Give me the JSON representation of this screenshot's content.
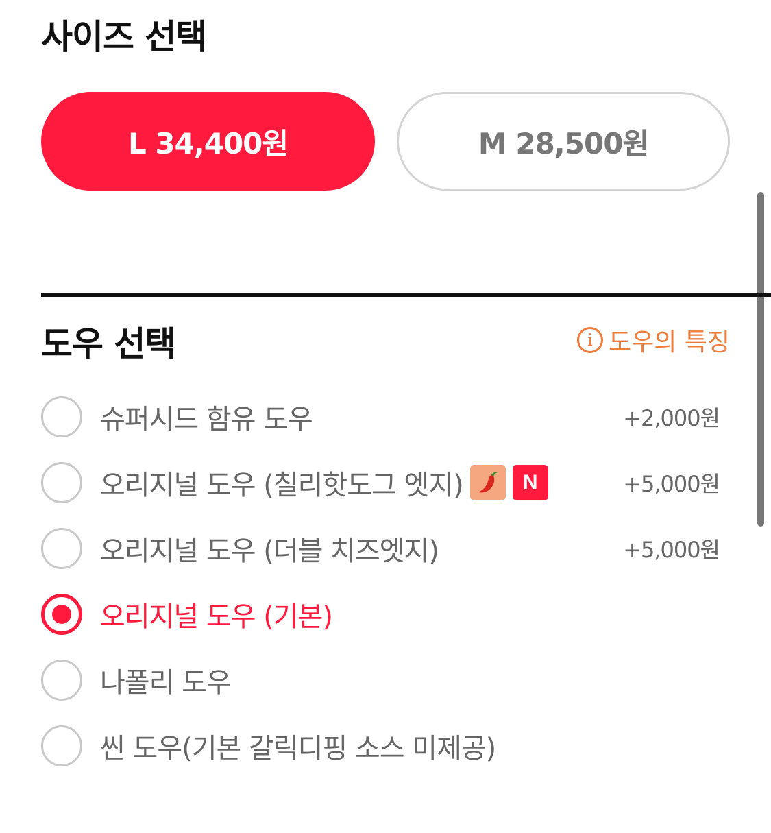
{
  "size_section": {
    "title": "사이즈 선택",
    "options": [
      {
        "label": "L 34,400원",
        "selected": true
      },
      {
        "label": "M 28,500원",
        "selected": false
      }
    ]
  },
  "dough_section": {
    "title": "도우 선택",
    "info_link": "도우의 특징",
    "info_icon": "info-icon",
    "options": [
      {
        "label": "슈퍼시드 함유 도우",
        "price": "+2,000원",
        "selected": false
      },
      {
        "label": "오리지널 도우 (칠리핫도그 엣지)",
        "price": "+5,000원",
        "selected": false,
        "badges": [
          "chili-pepper-icon",
          "N"
        ]
      },
      {
        "label": "오리지널 도우 (더블 치즈엣지)",
        "price": "+5,000원",
        "selected": false
      },
      {
        "label": "오리지널 도우 (기본)",
        "price": "",
        "selected": true
      },
      {
        "label": "나폴리 도우",
        "price": "",
        "selected": false
      },
      {
        "label": "씬 도우(기본 갈릭디핑 소스 미제공)",
        "price": "",
        "selected": false
      }
    ]
  },
  "colors": {
    "accent": "#ff1a3e",
    "info": "#ef7d3c",
    "text": "#111111",
    "muted": "#666666"
  }
}
